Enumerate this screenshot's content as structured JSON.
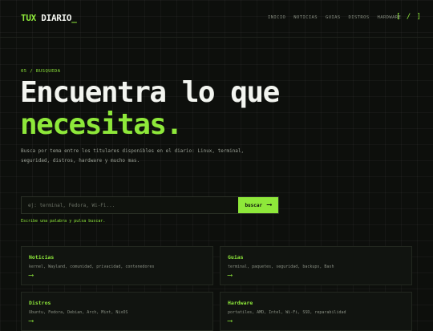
{
  "header": {
    "logo": {
      "part1": "TUX",
      "part2": "DIARIO",
      "cursor": "_"
    },
    "nav": [
      "INICIO",
      "NOTICIAS",
      "GUIAS",
      "DISTROS",
      "HARDWARE"
    ],
    "brackets": "[ / ]"
  },
  "hero": {
    "eyebrow": "05 / BUSQUEDA",
    "title_line1": "Encuentra lo que",
    "title_line2": "necesitas.",
    "description": "Busca por tema entre los titulares disponibles en el diario: Linux, terminal, seguridad, distros, hardware y mucho mas."
  },
  "search": {
    "placeholder": "ej: terminal, Fedora, Wi-Fi...",
    "button_label": "buscar",
    "button_icon": "arrow-right",
    "hint": "Escribe una palabra y pulsa buscar."
  },
  "cards": [
    {
      "title": "Noticias",
      "tags": "kernel, Wayland, comunidad, privacidad, contenedores",
      "icon": "arrow-right"
    },
    {
      "title": "Guias",
      "tags": "terminal, paquetes, seguridad, backups, Bash",
      "icon": "arrow-right"
    },
    {
      "title": "Distros",
      "tags": "Ubuntu, Fedora, Debian, Arch, Mint, NixOS",
      "icon": "arrow-right"
    },
    {
      "title": "Hardware",
      "tags": "portatiles, AMD, Intel, Wi-Fi, SSD, reparabilidad",
      "icon": "arrow-right"
    }
  ],
  "colors": {
    "accent": "#8ee83a",
    "background": "#0d0f0c",
    "text": "#f3f5f0"
  }
}
